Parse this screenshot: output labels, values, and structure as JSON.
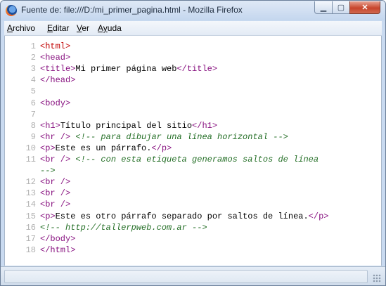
{
  "window": {
    "title": "Fuente de: file:///D:/mi_primer_pagina.html - Mozilla Firefox",
    "minimize_glyph": "▁",
    "maximize_glyph": "▢",
    "close_glyph": "✕",
    "icon": "firefox-icon"
  },
  "menubar": {
    "items": [
      {
        "underline": "A",
        "rest": "rchivo"
      },
      {
        "underline": "E",
        "rest": "ditar"
      },
      {
        "underline": "V",
        "rest": "er"
      },
      {
        "underline": "Ay",
        "rest": "uda"
      }
    ]
  },
  "source": {
    "lines": [
      {
        "n": "1",
        "parts": [
          {
            "t": "<html>",
            "c": "red"
          }
        ]
      },
      {
        "n": "2",
        "parts": [
          {
            "t": "<head>",
            "c": "purple"
          }
        ]
      },
      {
        "n": "3",
        "parts": [
          {
            "t": "<title>",
            "c": "purple"
          },
          {
            "t": "Mi primer página web",
            "c": "text"
          },
          {
            "t": "</title>",
            "c": "purple"
          }
        ]
      },
      {
        "n": "4",
        "parts": [
          {
            "t": "</head>",
            "c": "purple"
          }
        ]
      },
      {
        "n": "5",
        "parts": []
      },
      {
        "n": "6",
        "parts": [
          {
            "t": "<body>",
            "c": "purple"
          }
        ]
      },
      {
        "n": "7",
        "parts": []
      },
      {
        "n": "8",
        "parts": [
          {
            "t": "<h1>",
            "c": "purple"
          },
          {
            "t": "Título principal del sitio",
            "c": "text"
          },
          {
            "t": "</h1>",
            "c": "purple"
          }
        ]
      },
      {
        "n": "9",
        "parts": [
          {
            "t": "<hr />",
            "c": "purple"
          },
          {
            "t": " ",
            "c": "text"
          },
          {
            "t": "<!-- para dibujar una línea horizontal -->",
            "c": "comment"
          }
        ]
      },
      {
        "n": "10",
        "parts": [
          {
            "t": "<p>",
            "c": "purple"
          },
          {
            "t": "Este es un párrafo.",
            "c": "text"
          },
          {
            "t": "</p>",
            "c": "purple"
          }
        ]
      },
      {
        "n": "11",
        "parts": [
          {
            "t": "<br />",
            "c": "purple"
          },
          {
            "t": " ",
            "c": "text"
          },
          {
            "t": "<!-- con esta etiqueta generamos saltos de línea",
            "c": "comment"
          }
        ]
      },
      {
        "n": "",
        "parts": [
          {
            "t": "-->",
            "c": "comment"
          }
        ]
      },
      {
        "n": "12",
        "parts": [
          {
            "t": "<br />",
            "c": "purple"
          }
        ]
      },
      {
        "n": "13",
        "parts": [
          {
            "t": "<br />",
            "c": "purple"
          }
        ]
      },
      {
        "n": "14",
        "parts": [
          {
            "t": "<br />",
            "c": "purple"
          }
        ]
      },
      {
        "n": "15",
        "parts": [
          {
            "t": "<p>",
            "c": "purple"
          },
          {
            "t": "Este es otro párrafo separado por saltos de línea.",
            "c": "text"
          },
          {
            "t": "</p>",
            "c": "purple"
          }
        ]
      },
      {
        "n": "16",
        "parts": [
          {
            "t": "<!-- http://tallerpweb.com.ar -->",
            "c": "comment"
          }
        ]
      },
      {
        "n": "17",
        "parts": [
          {
            "t": "</body>",
            "c": "purple"
          }
        ]
      },
      {
        "n": "18",
        "parts": [
          {
            "t": "</html>",
            "c": "purple"
          }
        ]
      }
    ]
  },
  "colors": {
    "tag_root": "#c00000",
    "tag": "#881280",
    "comment": "#236e25",
    "line_number": "#b0b0b0"
  }
}
